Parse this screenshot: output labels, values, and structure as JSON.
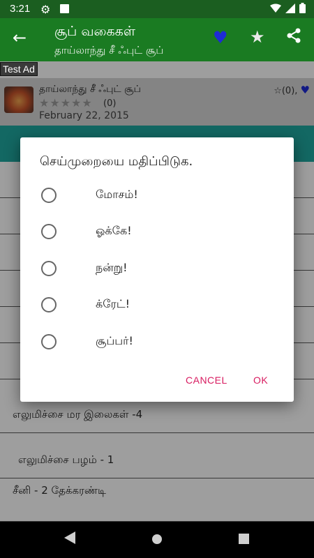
{
  "status": {
    "time": "3:21"
  },
  "appbar": {
    "title": "சூப் வகைகள்",
    "subtitle": "தாய்லாந்து சீ ஃபுட் சூப்"
  },
  "ad": {
    "label": "Test Ad"
  },
  "recipe_card": {
    "title": "தாய்லாந்து சீ ஃபுட் சூப்",
    "rating_count": "(0)",
    "date": "February 22, 2015",
    "favorites_count": "(0),"
  },
  "list": {
    "items": [
      "எலுமிச்சை மர இலைகள் -4",
      "எலுமிச்சை பழம் - 1",
      "சீனி - 2 தேக்கரண்டி"
    ]
  },
  "dialog": {
    "title": "செய்முறையை மதிப்பிடுக.",
    "options": [
      "மோசம்!",
      "ஓக்கே!",
      "நன்று!",
      "க்ரேட்!",
      "சூப்பர்!"
    ],
    "cancel": "CANCEL",
    "ok": "OK"
  },
  "colors": {
    "appbar": "#1a7b22",
    "accent": "#d81b60",
    "favorite": "#1e2ad6",
    "teal": "#1fa8a0"
  }
}
